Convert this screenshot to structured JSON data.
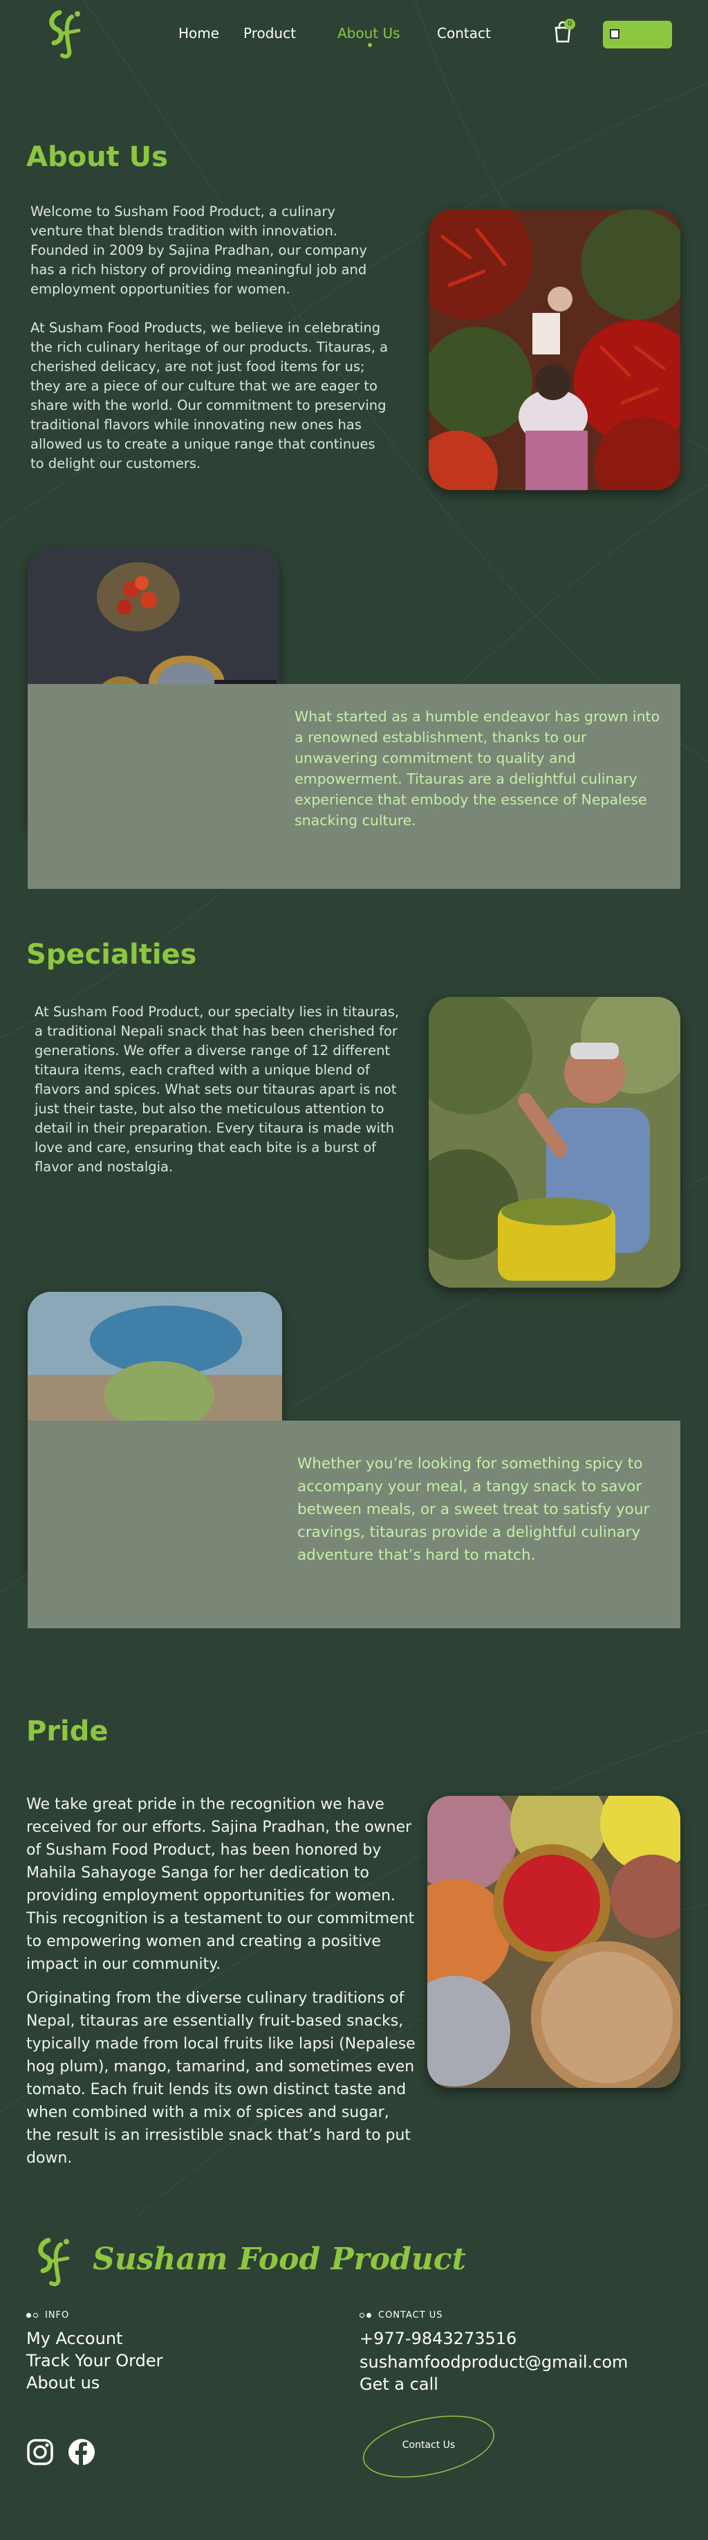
{
  "nav": {
    "links": [
      "Home",
      "Product",
      "About Us",
      "Contact"
    ],
    "active": "About Us",
    "cart_count": "0"
  },
  "about": {
    "title": "About Us",
    "paragraphs": [
      "Welcome to Susham Food Product, a culinary venture that blends tradition with innovation. Founded in 2009 by Sajina Pradhan, our company has a rich history of providing meaningful job and employment opportunities for women.",
      "At Susham Food Products, we believe in celebrating the rich culinary heritage of our products. Titauras, a cherished delicacy, are not just food items for us; they are a piece of our culture that we are eager to share with the world. Our commitment to preserving traditional flavors while innovating new ones has allowed us to create a unique range that continues to delight our customers."
    ],
    "band_text": "What started as a humble endeavor has grown into a renowned establishment, thanks to our unwavering commitment to quality and empowerment.  Titauras are a delightful culinary experience that embody the essence of Nepalese snacking culture."
  },
  "specialties": {
    "title": "Specialties",
    "paragraph": "At Susham Food Product, our specialty lies in titauras, a traditional Nepali snack that has been cherished for generations. We offer a diverse range of 12 different titaura items, each crafted with a unique blend of flavors and spices. What sets our titauras apart is not just their taste, but also the meticulous attention to detail in their preparation. Every titaura is made with love and care, ensuring that each bite is a burst of flavor and nostalgia.",
    "band_text": "Whether you’re looking for something spicy to accompany your meal, a tangy snack to savor between meals, or a sweet treat to satisfy your cravings, titauras provide a delightful culinary adventure that’s hard to match."
  },
  "pride": {
    "title": "Pride",
    "paragraphs": [
      "We take great pride in the recognition we have received for our efforts. Sajina Pradhan, the owner of Susham Food Product, has been honored by Mahila Sahayoge Sanga for her dedication to providing employment opportunities for women. This recognition is a testament to our commitment to empowering women and creating a positive impact in our community.",
      "Originating from the diverse culinary traditions of Nepal, titauras are essentially fruit-based snacks, typically made from local fruits like lapsi (Nepalese hog plum), mango, tamarind, and sometimes even tomato. Each fruit lends its own distinct taste and when combined with a mix of spices and sugar, the result is an irresistible snack that’s hard to put down."
    ]
  },
  "footer": {
    "brand": "Susham Food Product",
    "info_heading": "INFO",
    "info_links": [
      "My Account",
      "Track Your Order",
      "About us"
    ],
    "contact_heading": "CONTACT US",
    "phone": "+977-9843273516",
    "email": "sushamfoodproduct@gmail.com",
    "call_label": "Get a call",
    "contact_button": "Contact Us"
  },
  "colors": {
    "background": "#2d4234",
    "accent": "#8dc63f",
    "band": "#7a8776"
  }
}
